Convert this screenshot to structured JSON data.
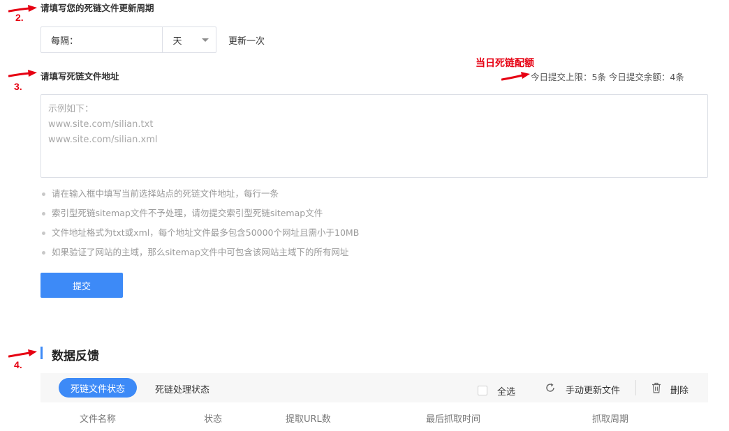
{
  "annotations": {
    "step2": "2.",
    "step3": "3.",
    "step4": "4.",
    "quota_title": "当日死链配额"
  },
  "cycle_section": {
    "label": "请填写您的死链文件更新周期",
    "interval_label": "每隔：",
    "unit_value": "天",
    "suffix": "更新一次"
  },
  "address_section": {
    "label": "请填写死链文件地址",
    "quota_text": "今日提交上限：5条    今日提交余额：4条",
    "placeholder_lines": [
      "示例如下：",
      "www.site.com/silian.txt",
      "www.site.com/silian.xml"
    ],
    "tips": [
      "请在输入框中填写当前选择站点的死链文件地址，每行一条",
      "索引型死链sitemap文件不予处理，请勿提交索引型死链sitemap文件",
      "文件地址格式为txt或xml，每个地址文件最多包含50000个网址且需小于10MB",
      "如果验证了网站的主域，那么sitemap文件中可包含该网站主域下的所有网址"
    ],
    "submit_label": "提交"
  },
  "feedback": {
    "title": "数据反馈",
    "tabs": [
      "死链文件状态",
      "死链处理状态"
    ],
    "select_all": "全选",
    "refresh_label": "手动更新文件",
    "delete_label": "删除",
    "columns": [
      "文件名称",
      "状态",
      "提取URL数",
      "最后抓取时间",
      "抓取周期"
    ]
  },
  "colors": {
    "accent": "#3d8af7",
    "annotation_red": "#e60012"
  },
  "icons": {
    "arrow": "red-arrow-icon",
    "refresh": "refresh-icon",
    "delete": "trash-icon",
    "dropdown": "chevron-down-icon"
  }
}
